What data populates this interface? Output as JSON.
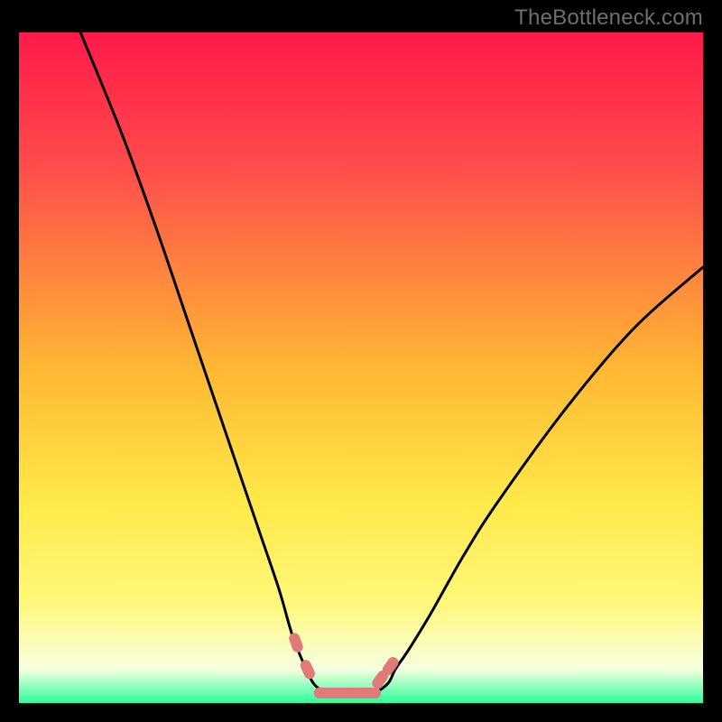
{
  "watermark": "TheBottleneck.com",
  "chart_data": {
    "type": "line",
    "title": "",
    "xlabel": "",
    "ylabel": "",
    "xlim": [
      0,
      100
    ],
    "ylim": [
      0,
      100
    ],
    "grid": false,
    "legend": false,
    "series": [
      {
        "name": "left-curve",
        "x": [
          9,
          15,
          20,
          25,
          30,
          35,
          38,
          40,
          42,
          43,
          44,
          45,
          46.2
        ],
        "y": [
          100,
          85,
          71,
          56,
          41,
          26,
          17,
          10,
          5,
          3,
          2,
          1.2,
          1.5
        ]
      },
      {
        "name": "right-curve",
        "x": [
          46.2,
          48,
          50,
          52,
          54,
          55,
          57,
          60,
          65,
          70,
          80,
          90,
          100
        ],
        "y": [
          1.5,
          1.2,
          1.2,
          1.5,
          3,
          5,
          8,
          13,
          22,
          30,
          44,
          56,
          65
        ]
      },
      {
        "name": "markers",
        "x": [
          40.5,
          42.2,
          46.0,
          50.0,
          52.8,
          54.3
        ],
        "y": [
          9.0,
          5.0,
          1.5,
          1.5,
          3.5,
          5.5
        ]
      }
    ],
    "colors": {
      "curve": "#000000",
      "marker": "#e27a7a",
      "background_top": "#ff1a4a",
      "background_bottom": "#2cfc9a"
    }
  }
}
